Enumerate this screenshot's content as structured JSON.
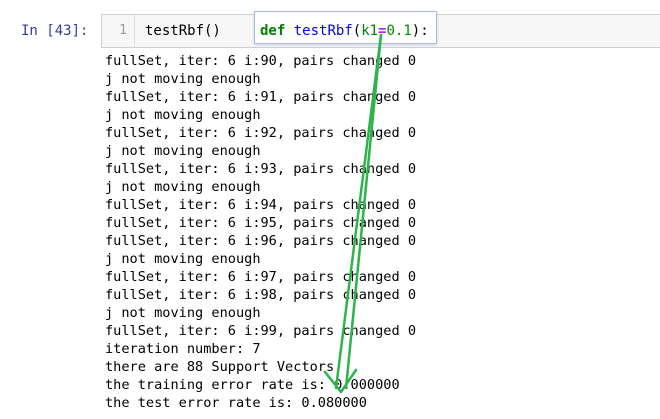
{
  "cell": {
    "prompt": "In [43]:",
    "line_number": "1",
    "code": "testRbf()"
  },
  "tooltip": {
    "signature": "def testRbf(k1=0.1):"
  },
  "output": [
    "fullSet, iter: 6 i:90, pairs changed 0",
    "j not moving enough",
    "fullSet, iter: 6 i:91, pairs changed 0",
    "j not moving enough",
    "fullSet, iter: 6 i:92, pairs changed 0",
    "j not moving enough",
    "fullSet, iter: 6 i:93, pairs changed 0",
    "j not moving enough",
    "fullSet, iter: 6 i:94, pairs changed 0",
    "fullSet, iter: 6 i:95, pairs changed 0",
    "fullSet, iter: 6 i:96, pairs changed 0",
    "j not moving enough",
    "fullSet, iter: 6 i:97, pairs changed 0",
    "fullSet, iter: 6 i:98, pairs changed 0",
    "j not moving enough",
    "fullSet, iter: 6 i:99, pairs changed 0",
    "iteration number: 7",
    "there are 88 Support Vectors",
    "the training error rate is: 0.000000",
    "the test error rate is: 0.080000"
  ],
  "colors": {
    "prompt": "#303f9f",
    "annotation_arrow": "#2db34a",
    "tooltip_border": "#9ec0e6"
  }
}
